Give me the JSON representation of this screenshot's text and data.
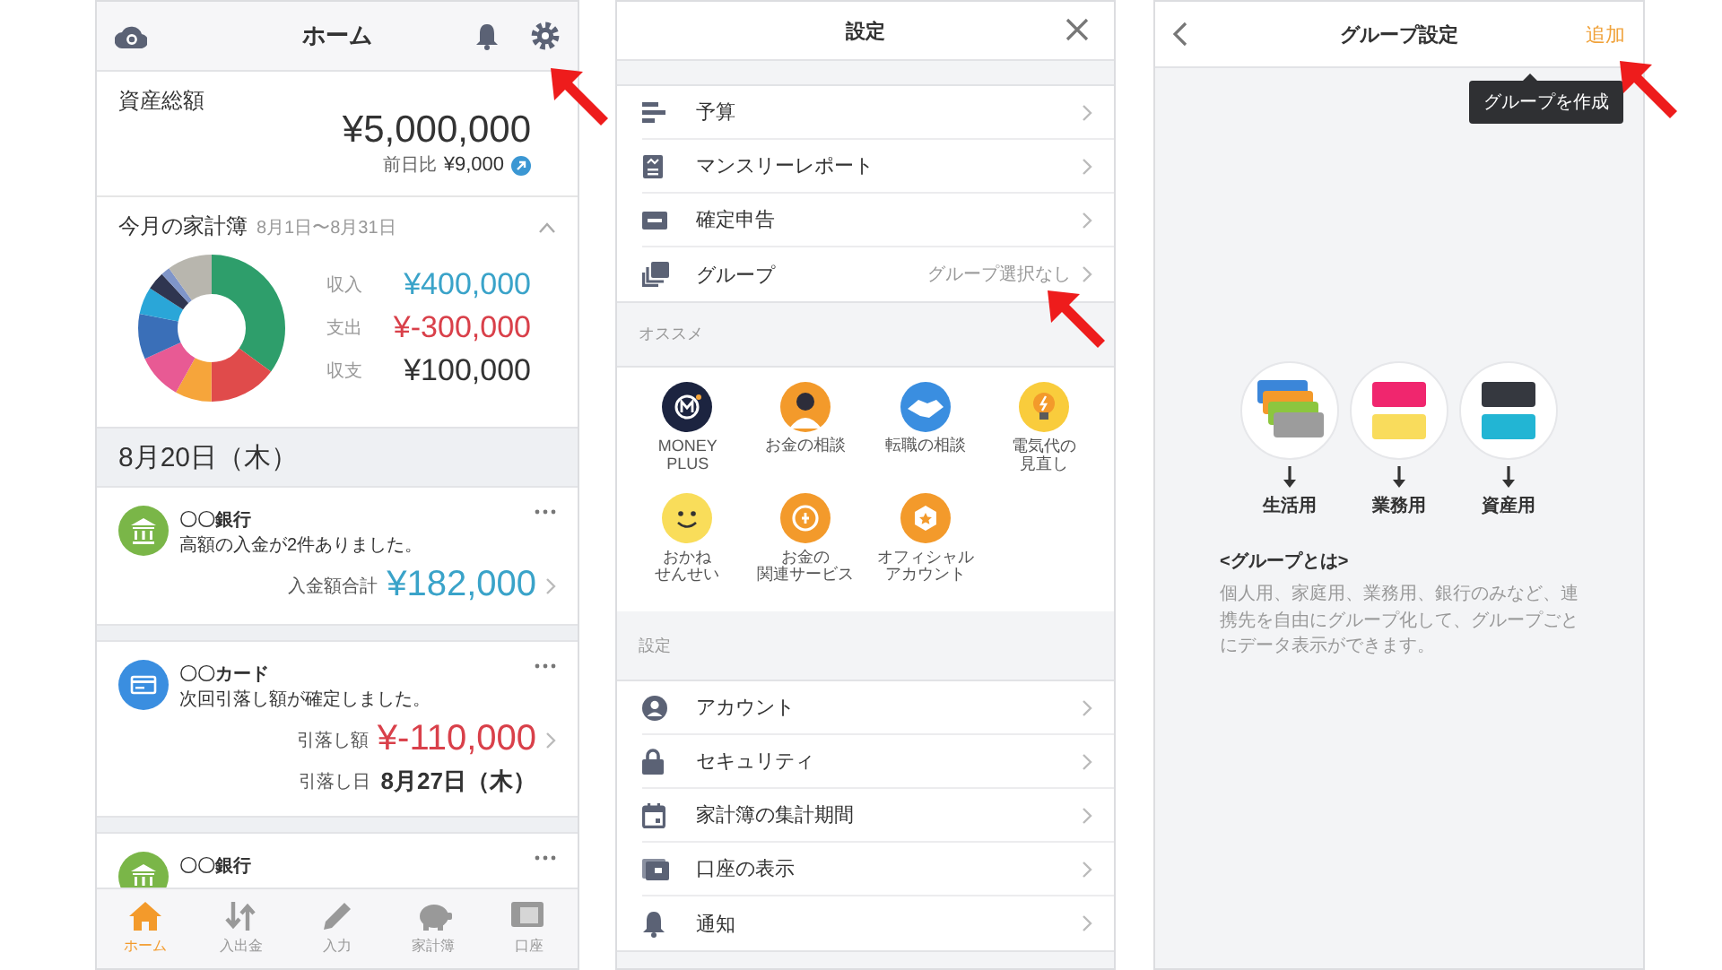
{
  "home": {
    "title": "ホーム",
    "assets": {
      "label": "資産総額",
      "amount": "¥5,000,000",
      "change_label": "前日比",
      "change": "¥9,000"
    },
    "budget": {
      "title": "今月の家計簿",
      "period": "8月1日〜8月31日",
      "expanded": true,
      "rows": [
        {
          "label": "収入",
          "amount": "¥400,000",
          "kind": "income"
        },
        {
          "label": "支出",
          "amount": "¥-300,000",
          "kind": "expense"
        },
        {
          "label": "収支",
          "amount": "¥100,000",
          "kind": "balance"
        }
      ]
    },
    "date": "8月20日（木）",
    "notices": [
      {
        "kind": "bank",
        "title": "〇〇銀行",
        "message": "高額の入金が2件ありました。",
        "amount_label": "入金額合計",
        "amount": "¥182,000"
      },
      {
        "kind": "card",
        "title": "〇〇カード",
        "message": "次回引落し額が確定しました。",
        "amount_label": "引落し額",
        "amount": "¥-110,000",
        "date_label": "引落し日",
        "date": "8月27日（木）"
      },
      {
        "kind": "bank",
        "title": "〇〇銀行"
      }
    ],
    "tabs": [
      {
        "label": "ホーム",
        "selected": true
      },
      {
        "label": "入出金",
        "selected": false
      },
      {
        "label": "入力",
        "selected": false
      },
      {
        "label": "家計簿",
        "selected": false
      },
      {
        "label": "口座",
        "selected": false
      }
    ]
  },
  "settings": {
    "title": "設定",
    "menu": [
      {
        "label": "予算"
      },
      {
        "label": "マンスリーレポート"
      },
      {
        "label": "確定申告"
      },
      {
        "label": "グループ",
        "value": "グループ選択なし"
      }
    ],
    "recommend_title": "オススメ",
    "recommend": [
      {
        "lines": [
          "MONEY",
          "PLUS"
        ]
      },
      {
        "lines": [
          "お金の相談"
        ]
      },
      {
        "lines": [
          "転職の相談"
        ]
      },
      {
        "lines": [
          "電気代の",
          "見直し"
        ]
      },
      {
        "lines": [
          "おかね",
          "せんせい"
        ]
      },
      {
        "lines": [
          "お金の",
          "関連サービス"
        ]
      },
      {
        "lines": [
          "オフィシャル",
          "アカウント"
        ]
      }
    ],
    "settings_title": "設定",
    "settings_menu": [
      {
        "label": "アカウント"
      },
      {
        "label": "セキュリティ"
      },
      {
        "label": "家計簿の集計期間"
      },
      {
        "label": "口座の表示"
      },
      {
        "label": "通知"
      }
    ]
  },
  "group_settings": {
    "title": "グループ設定",
    "add": "追加",
    "tooltip": "グループを作成",
    "groups": [
      {
        "label": "生活用"
      },
      {
        "label": "業務用"
      },
      {
        "label": "資産用"
      }
    ],
    "about_title": "<グループとは>",
    "about_text": "個人用、家庭用、業務用、銀行のみなど、連携先を自由にグループ化して、グループごとにデータ表示ができます。"
  }
}
